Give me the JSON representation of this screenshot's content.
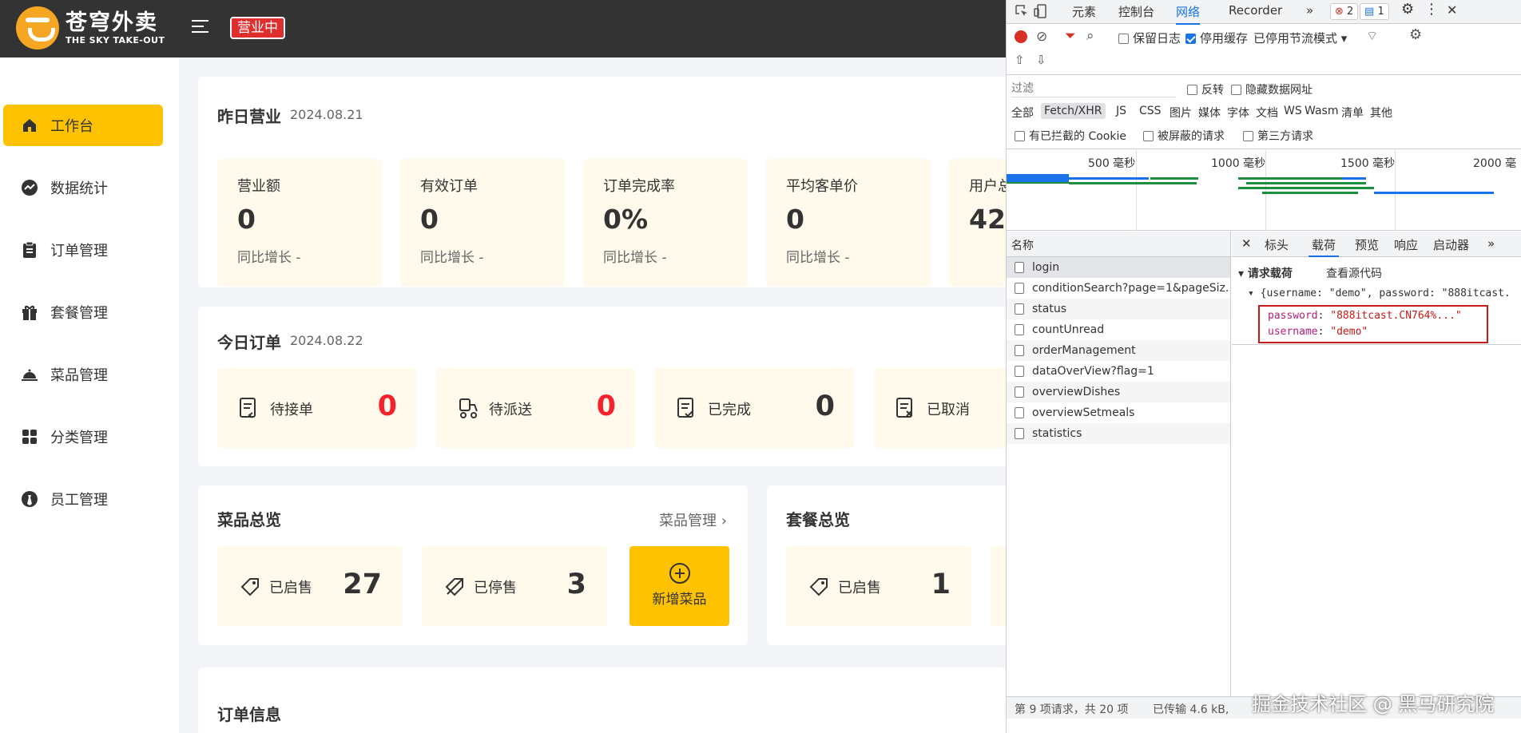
{
  "header": {
    "brand_cn": "苍穹外卖",
    "brand_en": "THE SKY TAKE-OUT",
    "status": "营业中"
  },
  "sidebar": {
    "items": [
      {
        "label": "工作台",
        "icon": "home-icon"
      },
      {
        "label": "数据统计",
        "icon": "chart-icon"
      },
      {
        "label": "订单管理",
        "icon": "clipboard-icon"
      },
      {
        "label": "套餐管理",
        "icon": "gift-icon"
      },
      {
        "label": "菜品管理",
        "icon": "dish-icon"
      },
      {
        "label": "分类管理",
        "icon": "grid-icon"
      },
      {
        "label": "员工管理",
        "icon": "user-icon"
      }
    ]
  },
  "yesterday": {
    "title": "昨日营业",
    "date": "2024.08.21",
    "stats": [
      {
        "label": "营业额",
        "value": "0",
        "sub": "同比增长 -"
      },
      {
        "label": "有效订单",
        "value": "0",
        "sub": "同比增长 -"
      },
      {
        "label": "订单完成率",
        "value": "0%",
        "sub": "同比增长 -"
      },
      {
        "label": "平均客单价",
        "value": "0",
        "sub": "同比增长 -"
      },
      {
        "label": "用户总",
        "value": "42",
        "sub": ""
      }
    ]
  },
  "today": {
    "title": "今日订单",
    "date": "2024.08.22",
    "orders": [
      {
        "label": "待接单",
        "value": "0"
      },
      {
        "label": "待派送",
        "value": "0"
      },
      {
        "label": "已完成",
        "value": "0"
      },
      {
        "label": "已取消",
        "value": ""
      }
    ]
  },
  "dishes": {
    "title": "菜品总览",
    "link": "菜品管理",
    "on_sale_label": "已启售",
    "on_sale": "27",
    "off_sale_label": "已停售",
    "off_sale": "3",
    "add_label": "新增菜品"
  },
  "setmeals": {
    "title": "套餐总览",
    "on_sale_label": "已启售",
    "on_sale": "1"
  },
  "orders_info": {
    "title": "订单信息"
  },
  "devtools": {
    "tabs": [
      "元素",
      "控制台",
      "网络",
      "Recorder"
    ],
    "errors": "2",
    "messages": "1",
    "preserve_log": "保留日志",
    "disable_cache": "停用缓存",
    "throttle": "已停用节流模式",
    "filter_placeholder": "过滤",
    "invert": "反转",
    "hide_data_urls": "隐藏数据网址",
    "types": [
      "全部",
      "Fetch/XHR",
      "JS",
      "CSS",
      "图片",
      "媒体",
      "字体",
      "文档",
      "WS",
      "Wasm",
      "清单",
      "其他"
    ],
    "blocked_cookies": "有已拦截的 Cookie",
    "blocked_requests": "被屏蔽的请求",
    "third_party": "第三方请求",
    "timeline": [
      "500 毫秒",
      "1000 毫秒",
      "1500 毫秒",
      "2000 毫"
    ],
    "name_header": "名称",
    "requests": [
      "login",
      "conditionSearch?page=1&pageSiz...",
      "status",
      "countUnread",
      "orderManagement",
      "dataOverView?flag=1",
      "overviewDishes",
      "overviewSetmeals",
      "statistics"
    ],
    "detail_tabs": [
      "标头",
      "载荷",
      "预览",
      "响应",
      "启动器"
    ],
    "payload_title": "请求载荷",
    "view_source": "查看源代码",
    "payload_summary": "{username: \"demo\", password: \"888itcast.",
    "password_key": "password",
    "password_value": "\"888itcast.CN764%...\"",
    "username_key": "username",
    "username_value": "\"demo\"",
    "footer_count": "第 9 项请求，共 20 项",
    "footer_transfer": "已传输 4.6 kB,"
  },
  "watermark": "掘金技术社区 @ 黑马研究院"
}
